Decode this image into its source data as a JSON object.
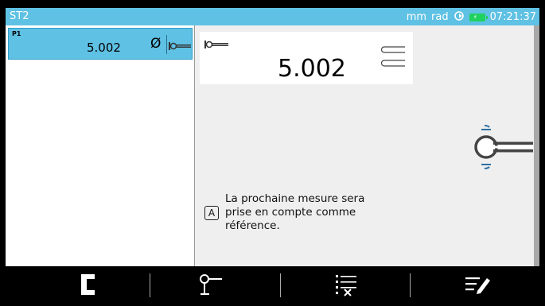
{
  "titlebar": {
    "title": "ST2",
    "unit_length": "mm",
    "unit_angle": "rad",
    "time": "07:21:37"
  },
  "list": {
    "items": [
      {
        "label": "P1",
        "value": "5.002",
        "symbol": "Ø"
      }
    ]
  },
  "measurement": {
    "value": "5.002"
  },
  "message": {
    "badge": "A",
    "text": "La prochaine mesure sera\nprise en compte comme\nréférence."
  },
  "icons": {
    "sync": "sync-icon",
    "battery": "battery-charging-icon",
    "probe": "probe-icon",
    "diameter": "diameter-icon",
    "bottom": [
      "bracket-icon",
      "probe-tip-icon",
      "delete-list-icon",
      "edit-list-icon"
    ]
  },
  "colors": {
    "accent": "#5fc1e4",
    "battery": "#1fd15e",
    "background": "#efefef"
  }
}
